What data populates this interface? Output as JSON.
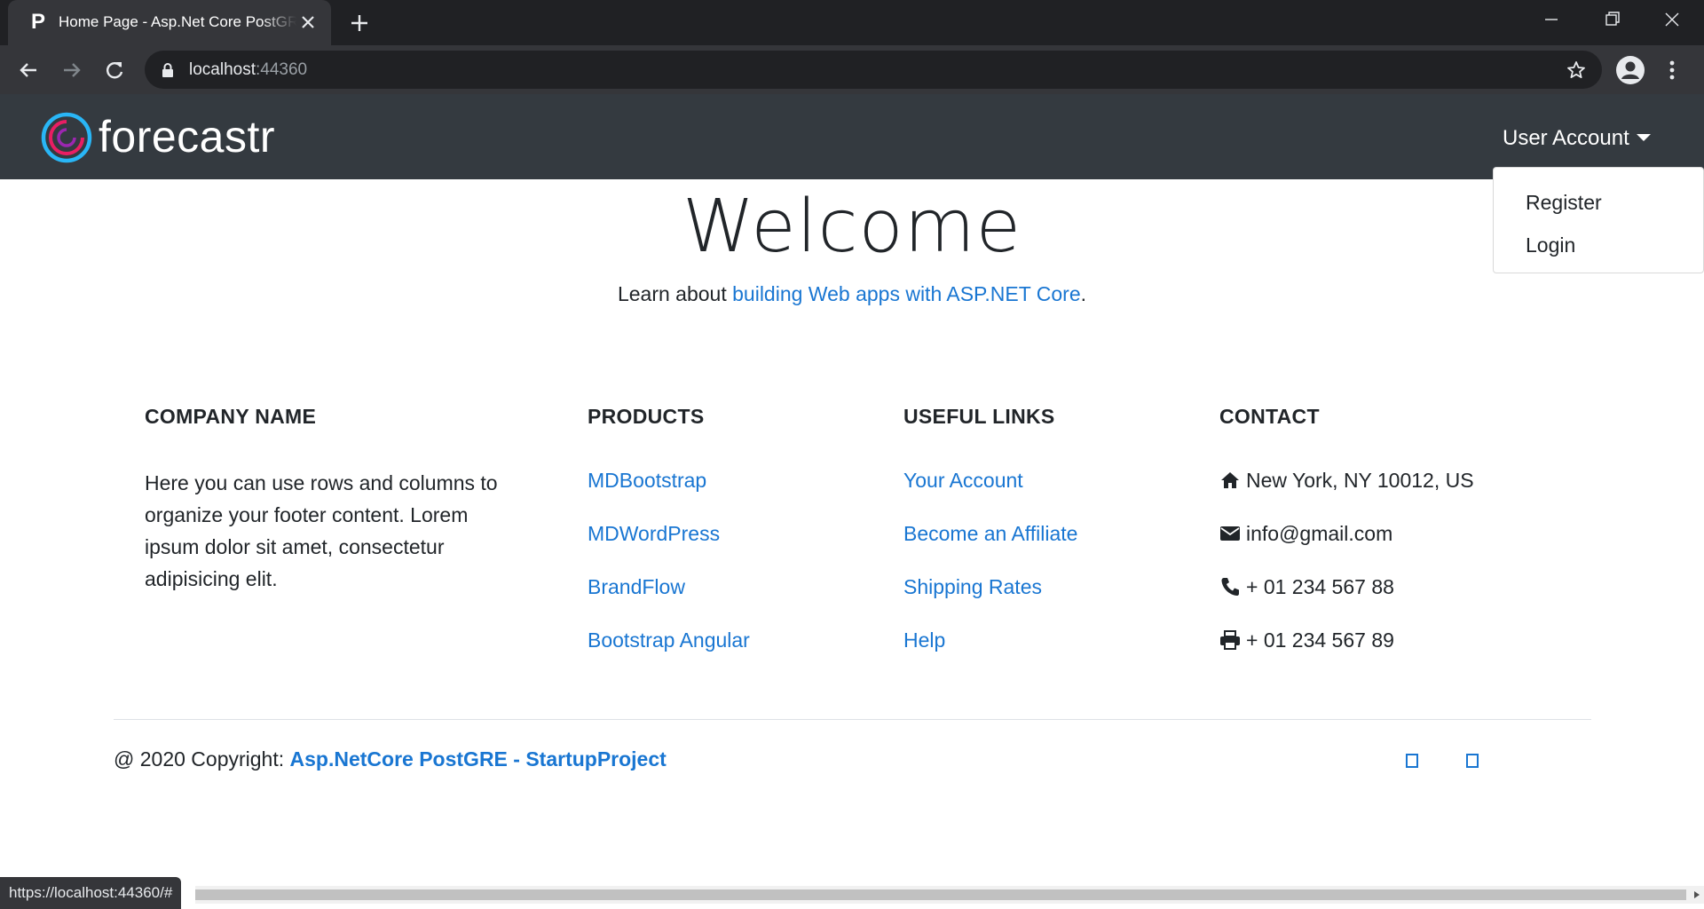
{
  "browser": {
    "tab_favicon": "P",
    "tab_title": "Home Page - Asp.Net Core PostGRE",
    "url_host": "localhost",
    "url_port": ":44360",
    "status_url": "https://localhost:44360/#"
  },
  "nav": {
    "brand": "forecastr",
    "user_account": "User Account",
    "dropdown": [
      "Register",
      "Login"
    ]
  },
  "main": {
    "heading": "Welcome",
    "lead_prefix": "Learn about ",
    "lead_link": "building Web apps with ASP.NET Core",
    "lead_suffix": "."
  },
  "footer": {
    "company": {
      "heading": "COMPANY NAME",
      "text": "Here you can use rows and columns to organize your footer content. Lorem ipsum dolor sit amet, consectetur adipisicing elit."
    },
    "products": {
      "heading": "PRODUCTS",
      "links": [
        "MDBootstrap",
        "MDWordPress",
        "BrandFlow",
        "Bootstrap Angular"
      ]
    },
    "useful_links": {
      "heading": "USEFUL LINKS",
      "links": [
        "Your Account",
        "Become an Affiliate",
        "Shipping Rates",
        "Help"
      ]
    },
    "contact": {
      "heading": "CONTACT",
      "address": "New York, NY 10012, US",
      "email": "info@gmail.com",
      "phone": "+ 01 234 567 88",
      "fax": "+ 01 234 567 89"
    },
    "copyright_prefix": "@ 2020 Copyright: ",
    "copyright_link": "Asp.NetCore PostGRE - StartupProject"
  },
  "colors": {
    "navbar": "#343a40",
    "link": "#1976d2",
    "logo_outer": "#29b6f6",
    "logo_inner": "#e91e63"
  }
}
